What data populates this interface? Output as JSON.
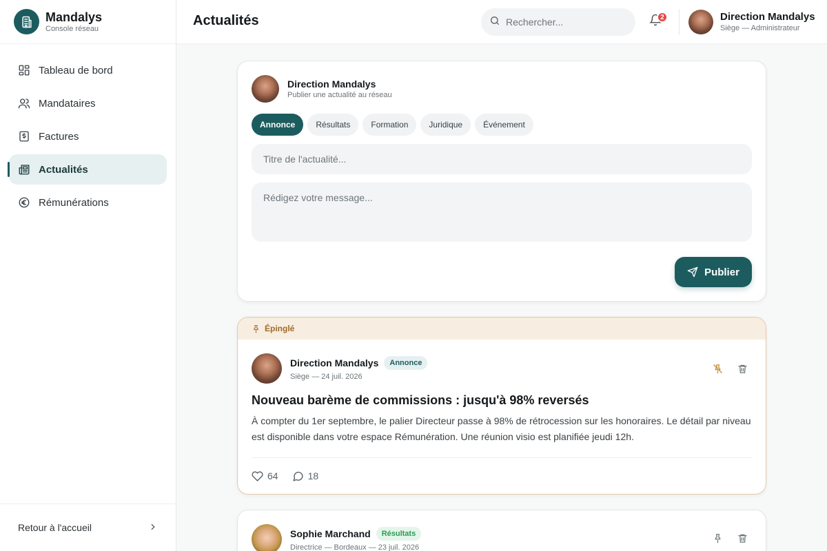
{
  "brand": {
    "name": "Mandalys",
    "subtitle": "Console réseau"
  },
  "sidebar": {
    "items": [
      {
        "label": "Tableau de bord",
        "icon": "dashboard-icon"
      },
      {
        "label": "Mandataires",
        "icon": "users-icon"
      },
      {
        "label": "Factures",
        "icon": "invoice-icon"
      },
      {
        "label": "Actualités",
        "icon": "newspaper-icon",
        "active": true
      },
      {
        "label": "Rémunérations",
        "icon": "euro-icon"
      }
    ],
    "footer_label": "Retour à l'accueil"
  },
  "header": {
    "title": "Actualités",
    "search_placeholder": "Rechercher...",
    "notifications_count": "2",
    "user_name": "Direction Mandalys",
    "user_role": "Siège — Administrateur"
  },
  "composer": {
    "author": "Direction Mandalys",
    "subtitle": "Publier une actualité au réseau",
    "categories": [
      "Annonce",
      "Résultats",
      "Formation",
      "Juridique",
      "Événement"
    ],
    "active_category": "Annonce",
    "title_placeholder": "Titre de l'actualité...",
    "message_placeholder": "Rédigez votre message...",
    "publish_label": "Publier"
  },
  "posts": [
    {
      "pinned_label": "Épinglé",
      "author": "Direction Mandalys",
      "tag": "Annonce",
      "meta": "Siège — 24 juil. 2026",
      "title": "Nouveau barème de commissions : jusqu'à 98% reversés",
      "text": "À compter du 1er septembre, le palier Directeur passe à 98% de rétrocession sur les honoraires. Le détail par niveau est disponible dans votre espace Rémunération. Une réunion visio est planifiée jeudi 12h.",
      "likes": "64",
      "comments": "18"
    },
    {
      "author": "Sophie Marchand",
      "tag": "Résultats",
      "meta": "Directrice — Bordeaux — 23 juil. 2026"
    }
  ],
  "colors": {
    "accent": "#1c5c5f",
    "pinned": "#a26a2a",
    "badge": "#e04848",
    "results": "#2c9a56"
  }
}
